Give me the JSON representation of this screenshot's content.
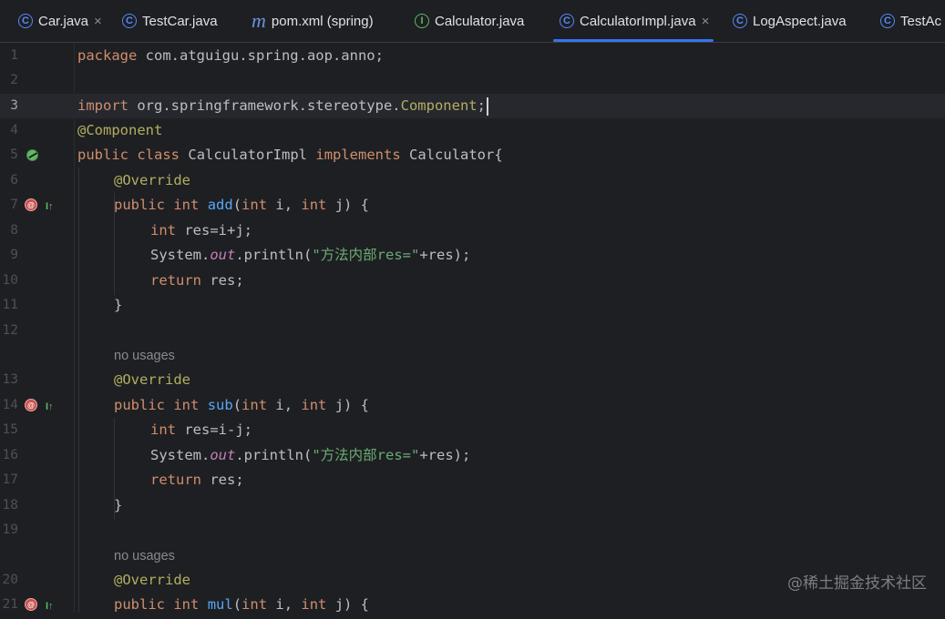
{
  "tabs": [
    {
      "label": "Car.java",
      "icon": "class-icon",
      "closable": true,
      "active": false
    },
    {
      "label": "TestCar.java",
      "icon": "class-icon",
      "closable": false,
      "active": false
    },
    {
      "label": "pom.xml (spring)",
      "icon": "maven-icon",
      "closable": false,
      "active": false
    },
    {
      "label": "Calculator.java",
      "icon": "interface-icon",
      "closable": false,
      "active": false
    },
    {
      "label": "CalculatorImpl.java",
      "icon": "class-icon",
      "closable": true,
      "active": true
    },
    {
      "label": "LogAspect.java",
      "icon": "class-icon",
      "closable": false,
      "active": false
    },
    {
      "label": "TestAc",
      "icon": "class-icon",
      "closable": false,
      "active": false
    }
  ],
  "tab_icon_glyphs": {
    "class": "C",
    "interface": "I",
    "maven": "m",
    "close": "×"
  },
  "editor": {
    "current_line": 3,
    "lines": {
      "1": "1",
      "2": "2",
      "3": "3",
      "4": "4",
      "5": "5",
      "6": "6",
      "7": "7",
      "8": "8",
      "9": "9",
      "10": "10",
      "11": "11",
      "12": "12",
      "13": "13",
      "14": "14",
      "15": "15",
      "16": "16",
      "17": "17",
      "18": "18",
      "19": "19",
      "20": "20",
      "21": "21"
    },
    "tokens": {
      "l1_kw": "package",
      "l1_rest": " com.atguigu.spring.aop.anno;",
      "l3_kw": "import",
      "l3_pkg": " org.springframework.stereotype.",
      "l3_cls": "Component",
      "l3_end": ";",
      "l4_ann": "@Component",
      "l5_kw1": "public",
      "l5_kw2": "class",
      "l5_name": "CalculatorImpl",
      "l5_kw3": "implements",
      "l5_iface": "Calculator{",
      "override": "@Override",
      "kw_public": "public",
      "kw_int": "int",
      "kw_return": "return",
      "m_add": "add",
      "m_sub": "sub",
      "m_mul": "mul",
      "params": "(int i, int j) {",
      "param_open": "(",
      "param_i": " i, ",
      "param_j": " j) {",
      "res_add": " res=i+j;",
      "res_sub": " res=i-j;",
      "sys": "System.",
      "out": "out",
      "println_open": ".println(",
      "str": "\"方法内部res=\"",
      "println_close": "+res);",
      "ret_rest": " res;",
      "brace": "}"
    },
    "hints": {
      "no_usages": "no usages"
    }
  },
  "watermark": "@稀土掘金技术社区"
}
